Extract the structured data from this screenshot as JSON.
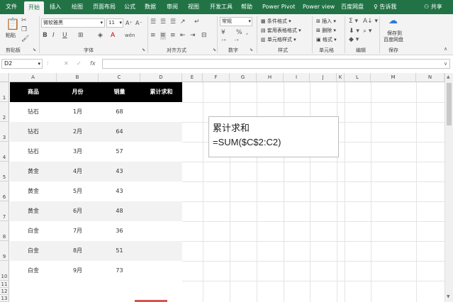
{
  "tabs": [
    "文件",
    "开始",
    "插入",
    "绘图",
    "页面布局",
    "公式",
    "数据",
    "审阅",
    "视图",
    "开发工具",
    "帮助",
    "Power Pivot",
    "Power view",
    "百度网盘"
  ],
  "active_tab": "开始",
  "tell_me": "告诉我",
  "share": "共享",
  "ribbon": {
    "paste": "粘贴",
    "clipboard": "剪贴板",
    "font_name": "微软雅黑",
    "font_size": "11",
    "bold": "B",
    "italic": "I",
    "underline": "U",
    "font_group": "字体",
    "align_group": "对齐方式",
    "number_format": "常规",
    "number_group": "数字",
    "cond_format": "条件格式",
    "table_format": "套用表格格式",
    "cell_style": "单元格样式",
    "styles_group": "样式",
    "insert": "插入",
    "delete": "删除",
    "format": "格式",
    "cells_group": "单元格",
    "edit_group": "编辑",
    "save_baidu_1": "保存到",
    "save_baidu_2": "百度网盘",
    "save_group": "保存"
  },
  "name_box": "D2",
  "fx": "fx",
  "columns": [
    "A",
    "B",
    "C",
    "D",
    "E",
    "F",
    "G",
    "H",
    "I",
    "J",
    "K",
    "L",
    "M",
    "N"
  ],
  "rows": [
    "1",
    "2",
    "3",
    "4",
    "5",
    "6",
    "7",
    "8",
    "9",
    "10",
    "11",
    "12",
    "13"
  ],
  "table": {
    "headers": [
      "商品",
      "月份",
      "销量",
      "累计求和"
    ],
    "rows": [
      [
        "钻石",
        "1月",
        "68"
      ],
      [
        "钻石",
        "2月",
        "64"
      ],
      [
        "钻石",
        "3月",
        "57"
      ],
      [
        "黄金",
        "4月",
        "43"
      ],
      [
        "黄金",
        "5月",
        "43"
      ],
      [
        "黄金",
        "6月",
        "48"
      ],
      [
        "白金",
        "7月",
        "36"
      ],
      [
        "白金",
        "8月",
        "51"
      ],
      [
        "白金",
        "9月",
        "73"
      ]
    ]
  },
  "note": {
    "line1": "累计求和",
    "line2": "=SUM($C$2:C2)"
  }
}
